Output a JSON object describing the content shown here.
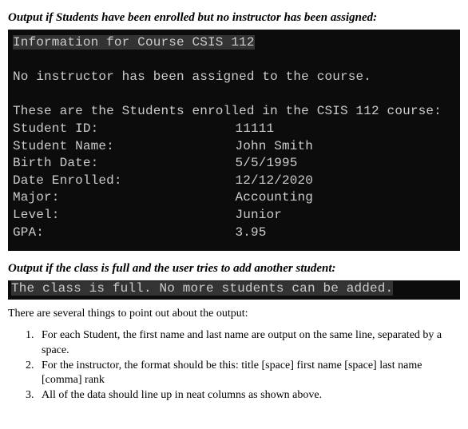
{
  "caption1": "Output if Students have been enrolled but no instructor has been assigned:",
  "terminal1": {
    "heading": "Information for Course CSIS 112",
    "noInstructor": "No instructor has been assigned to the course.",
    "studentsHeading": "These are the Students enrolled in the CSIS 112 course:",
    "rows": [
      {
        "label": "Student ID:",
        "value": "11111"
      },
      {
        "label": "Student Name:",
        "value": "John Smith"
      },
      {
        "label": "Birth Date:",
        "value": "5/5/1995"
      },
      {
        "label": "Date Enrolled:",
        "value": "12/12/2020"
      },
      {
        "label": "Major:",
        "value": "Accounting"
      },
      {
        "label": "Level:",
        "value": "Junior"
      },
      {
        "label": "GPA:",
        "value": "3.95"
      }
    ]
  },
  "caption2": "Output if the class is full and the user tries to add another student:",
  "terminal2": {
    "line": "The class is full. No more students can be added."
  },
  "closingText": "There are several things to point out about the output:",
  "list": [
    "For each Student, the first name and last name are output on the same line, separated by a space.",
    "For the instructor, the format should be this:   title [space] first name [space] last name [comma] rank",
    "All of the data should line up in neat columns as shown above."
  ]
}
